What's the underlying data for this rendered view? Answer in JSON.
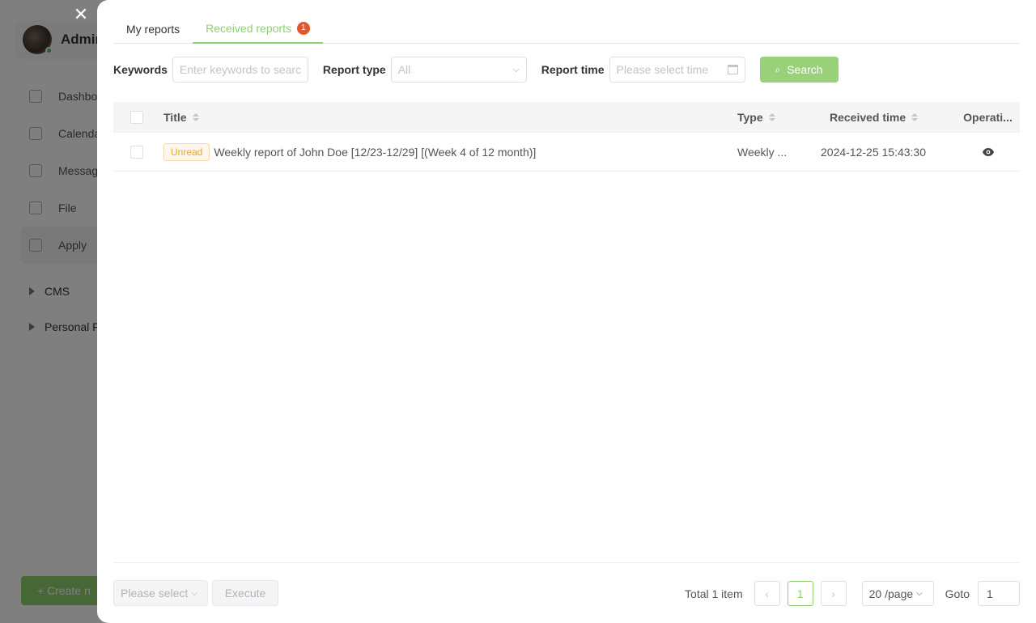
{
  "background": {
    "user": {
      "name": "Admin"
    },
    "nav_items": [
      {
        "label": "Dashboard",
        "icon": "dashboard-icon"
      },
      {
        "label": "Calendar",
        "icon": "calendar-icon"
      },
      {
        "label": "Messages",
        "icon": "message-icon"
      },
      {
        "label": "File",
        "icon": "file-icon"
      },
      {
        "label": "Apply",
        "icon": "apps-grid-icon",
        "active": true
      }
    ],
    "nav_groups": [
      {
        "label": "CMS"
      },
      {
        "label": "Personal F"
      }
    ],
    "create_button": "+ Create n"
  },
  "drawer": {
    "tabs": [
      {
        "label": "My reports",
        "active": false
      },
      {
        "label": "Received reports",
        "active": true,
        "badge": "1"
      }
    ],
    "filters": {
      "keywords_label": "Keywords",
      "keywords_placeholder": "Enter keywords to search",
      "report_type_label": "Report type",
      "report_type_value": "All",
      "report_time_label": "Report time",
      "report_time_placeholder": "Please select time",
      "search_button": "Search"
    },
    "table": {
      "columns": {
        "title": "Title",
        "type": "Type",
        "received_time": "Received time",
        "operation": "Operati..."
      },
      "rows": [
        {
          "status_tag": "Unread",
          "title": "Weekly report of John Doe [12/23-12/29] [(Week 4 of 12 month)]",
          "type": "Weekly ...",
          "received_time": "2024-12-25 15:43:30"
        }
      ]
    },
    "footer": {
      "batch_select_placeholder": "Please select",
      "execute_button": "Execute",
      "total_text": "Total 1 item",
      "current_page": "1",
      "page_size": "20 /page",
      "goto_label": "Goto",
      "goto_value": "1"
    }
  },
  "colors": {
    "accent": "#8fcf6f",
    "badge": "#e4572e",
    "unread_tag": "#e6a23c"
  }
}
